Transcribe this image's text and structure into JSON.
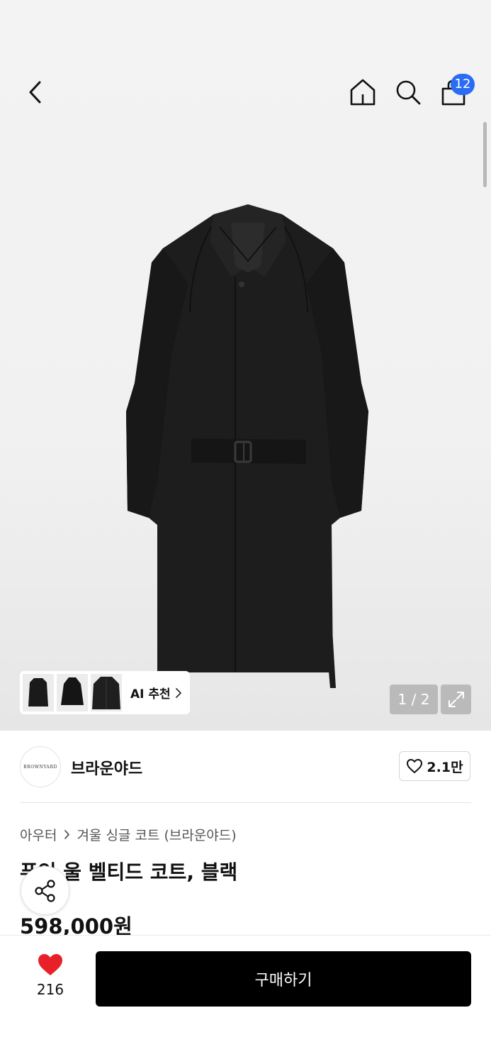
{
  "header": {
    "cart_count": "12"
  },
  "gallery": {
    "ai_label": "AI 추천",
    "page_indicator": "1 / 2"
  },
  "brand": {
    "logo_text": "BROWNYARD",
    "name": "브라운야드",
    "likes": "2.1만"
  },
  "breadcrumb": {
    "category": "아우터",
    "subcategory": "겨울 싱글 코트 (브라운야드)"
  },
  "product": {
    "title": "푸잇 울 벨티드 코트, 블랙",
    "price": "598,000원"
  },
  "bottom": {
    "wish_count": "216",
    "buy_label": "구매하기"
  },
  "colors": {
    "accent_badge": "#2a6df4",
    "heart": "#e8202a",
    "buy_button": "#000000"
  },
  "icons": [
    "back-icon",
    "home-icon",
    "search-icon",
    "shopping-bag-icon",
    "chevron-right-icon",
    "expand-icon",
    "heart-outline-icon",
    "share-icon",
    "heart-filled-icon"
  ]
}
